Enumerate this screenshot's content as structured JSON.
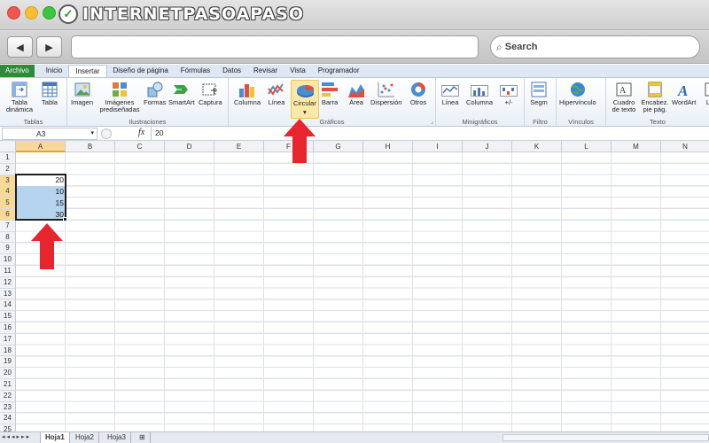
{
  "browser": {
    "logo_text": "INTERNETPASOAPASO",
    "search_placeholder": "Search",
    "nav_back_icon": "back-arrow-icon",
    "nav_forward_icon": "forward-arrow-icon"
  },
  "ribbon": {
    "tabs": [
      "Archivo",
      "Inicio",
      "Insertar",
      "Diseño de página",
      "Fórmulas",
      "Datos",
      "Revisar",
      "Vista",
      "Programador"
    ],
    "active_tab": "Insertar",
    "groups": {
      "tablas": {
        "label": "Tablas",
        "buttons": [
          "Tabla dinámica",
          "Tabla"
        ]
      },
      "ilustraciones": {
        "label": "Ilustraciones",
        "buttons": [
          "Imagen",
          "Imágenes prediseñadas",
          "Formas",
          "SmartArt",
          "Captura"
        ]
      },
      "graficos": {
        "label": "Gráficos",
        "buttons": [
          "Columna",
          "Línea",
          "Circular",
          "Barra",
          "Área",
          "Dispersión",
          "Otros"
        ]
      },
      "minigraficos": {
        "label": "Minigráficos",
        "buttons": [
          "Línea",
          "Columna",
          "+/-"
        ]
      },
      "filtro": {
        "label": "Filtro",
        "buttons": [
          "Segm"
        ]
      },
      "vinculos": {
        "label": "Vínculos",
        "buttons": [
          "Hipervínculo"
        ]
      },
      "texto": {
        "label": "Texto",
        "buttons": [
          "Cuadro de texto",
          "Encabez. pie pág.",
          "WordArt",
          "Lí"
        ]
      }
    },
    "highlighted_button": "Circular"
  },
  "formula_bar": {
    "name_box": "A3",
    "fx_label": "fx",
    "content": "20"
  },
  "grid": {
    "columns": [
      "A",
      "B",
      "C",
      "D",
      "E",
      "F",
      "G",
      "H",
      "I",
      "J",
      "K",
      "L",
      "M",
      "N"
    ],
    "rows": [
      "1",
      "2",
      "3",
      "4",
      "5",
      "6",
      "7",
      "8",
      "9",
      "10",
      "11",
      "12",
      "13",
      "14",
      "15",
      "16",
      "17",
      "18",
      "19",
      "20",
      "21",
      "22",
      "23",
      "24",
      "25"
    ],
    "cells": {
      "A3": "20",
      "A4": "10",
      "A5": "15",
      "A6": "30"
    },
    "selected_range": "A3:A6",
    "selection_color": "#b6d4ee"
  },
  "sheets": {
    "tabs": [
      "Hoja1",
      "Hoja2",
      "Hoja3"
    ],
    "active": "Hoja1"
  },
  "colors": {
    "annotation_arrow": "#e8242c",
    "file_tab": "#2f8a3a",
    "highlight": "#fce9a8"
  }
}
